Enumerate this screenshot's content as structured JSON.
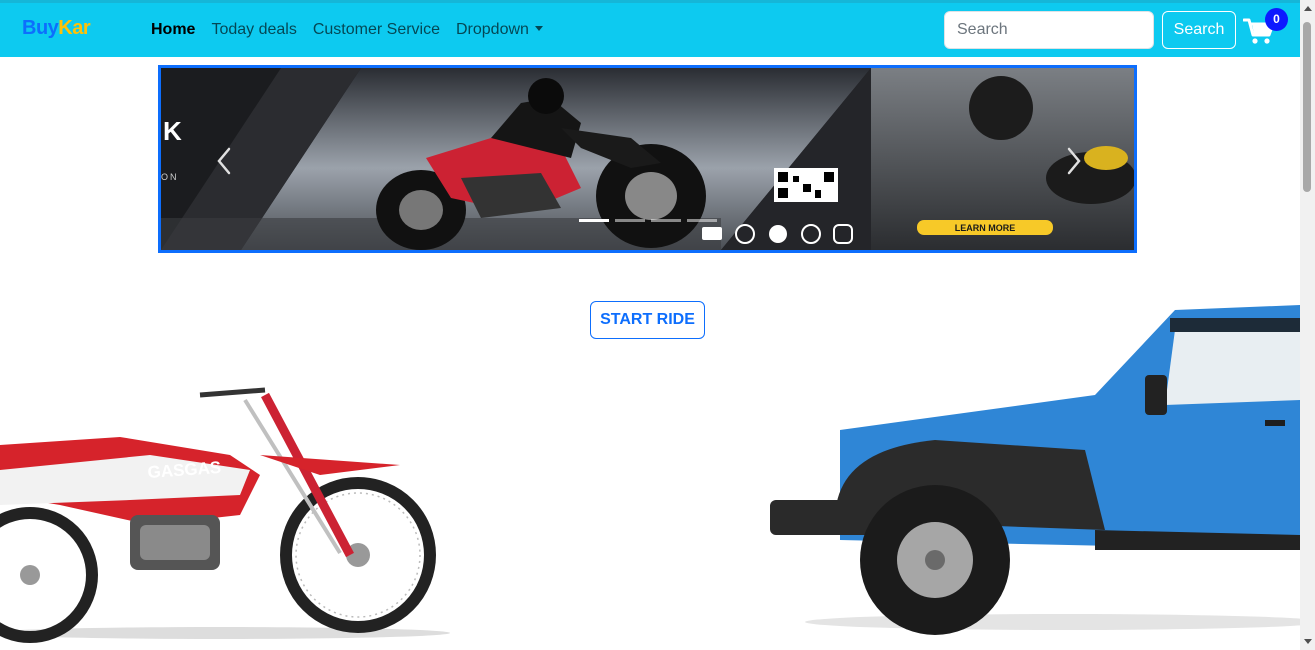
{
  "brand": {
    "part1": "Buy",
    "part2": "Kar"
  },
  "nav": {
    "items": [
      {
        "label": "Home",
        "active": true
      },
      {
        "label": "Today deals",
        "active": false
      },
      {
        "label": "Customer Service",
        "active": false
      },
      {
        "label": "Dropdown",
        "active": false
      }
    ]
  },
  "search": {
    "placeholder": "Search",
    "button_label": "Search"
  },
  "cart": {
    "count": "0"
  },
  "banner": {
    "cta_label": "LEARN MORE",
    "social_icons": [
      "linkedin-icon",
      "twitter-icon",
      "facebook-icon",
      "youtube-icon",
      "instagram-icon"
    ],
    "indicator_count": 4
  },
  "main": {
    "start_button_label": "START RIDE"
  },
  "colors": {
    "navbar": "#0dcaf0",
    "primary": "#0d6efd",
    "brand_accent": "#ffc107",
    "bike_red": "#d6232b",
    "jeep_blue": "#2f86d6"
  }
}
